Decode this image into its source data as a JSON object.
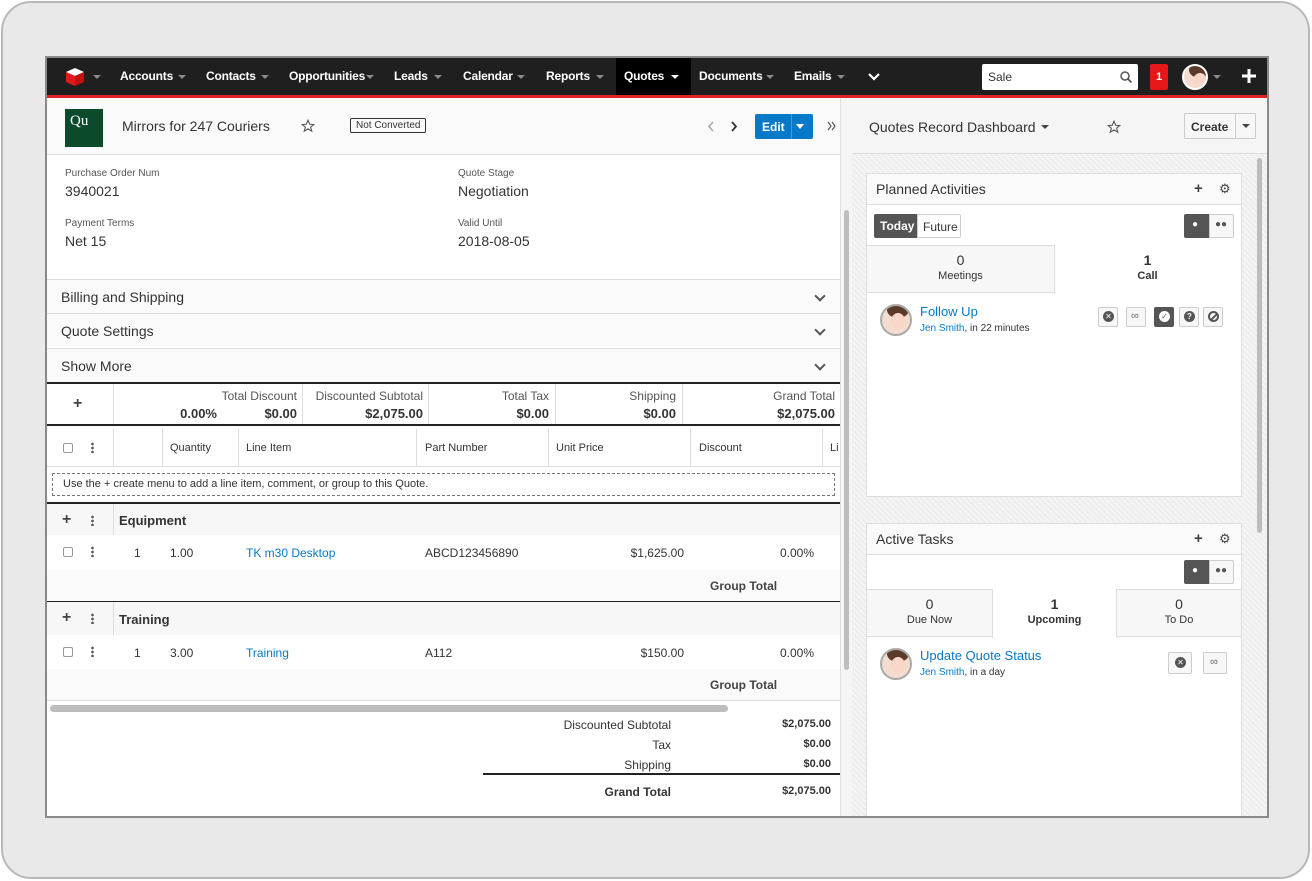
{
  "nav": {
    "items": [
      "Accounts",
      "Contacts",
      "Opportunities",
      "Leads",
      "Calendar",
      "Reports",
      "Quotes",
      "Documents",
      "Emails"
    ],
    "search_value": "Sale",
    "notifications": "1"
  },
  "record": {
    "badge": "Qu",
    "title": "Mirrors for 247 Couriers",
    "status": "Not Converted",
    "edit_label": "Edit",
    "fields": {
      "po_label": "Purchase Order Num",
      "po_value": "3940021",
      "stage_label": "Quote Stage",
      "stage_value": "Negotiation",
      "terms_label": "Payment Terms",
      "terms_value": "Net 15",
      "valid_label": "Valid Until",
      "valid_value": "2018-08-05"
    },
    "panels": [
      "Billing and Shipping",
      "Quote Settings",
      "Show More"
    ]
  },
  "totals": {
    "discount_label": "Total Discount",
    "discount_pct": "0.00%",
    "discount_value": "$0.00",
    "subtotal_label": "Discounted Subtotal",
    "subtotal_value": "$2,075.00",
    "tax_label": "Total Tax",
    "tax_value": "$0.00",
    "shipping_label": "Shipping",
    "shipping_value": "$0.00",
    "grand_label": "Grand Total",
    "grand_value": "$2,075.00"
  },
  "table": {
    "headers": [
      "Quantity",
      "Line Item",
      "Part Number",
      "Unit Price",
      "Discount",
      "Li"
    ],
    "hint": "Use the + create menu to add a line item, comment, or group to this Quote.",
    "groups": [
      {
        "name": "Equipment",
        "row": {
          "num": "1",
          "qty": "1.00",
          "item": "TK m30 Desktop",
          "part": "ABCD123456890",
          "price": "$1,625.00",
          "discount": "0.00%"
        },
        "total_label": "Group Total"
      },
      {
        "name": "Training",
        "row": {
          "num": "1",
          "qty": "3.00",
          "item": "Training",
          "part": "A112",
          "price": "$150.00",
          "discount": "0.00%"
        },
        "total_label": "Group Total"
      }
    ]
  },
  "summary": {
    "subtotal_label": "Discounted Subtotal",
    "subtotal_value": "$2,075.00",
    "tax_label": "Tax",
    "tax_value": "$0.00",
    "shipping_label": "Shipping",
    "shipping_value": "$0.00",
    "grand_label": "Grand Total",
    "grand_value": "$2,075.00"
  },
  "dashboard": {
    "title": "Quotes Record Dashboard",
    "create_label": "Create",
    "planned": {
      "title": "Planned Activities",
      "today": "Today",
      "future": "Future",
      "meetings_count": "0",
      "meetings_label": "Meetings",
      "call_count": "1",
      "call_label": "Call",
      "item_title": "Follow Up",
      "item_user": "Jen Smith",
      "item_when": ", in 22 minutes"
    },
    "tasks": {
      "title": "Active Tasks",
      "due_count": "0",
      "due_label": "Due Now",
      "upcoming_count": "1",
      "upcoming_label": "Upcoming",
      "todo_count": "0",
      "todo_label": "To Do",
      "item_title": "Update Quote Status",
      "item_user": "Jen Smith",
      "item_when": ", in a day"
    }
  }
}
